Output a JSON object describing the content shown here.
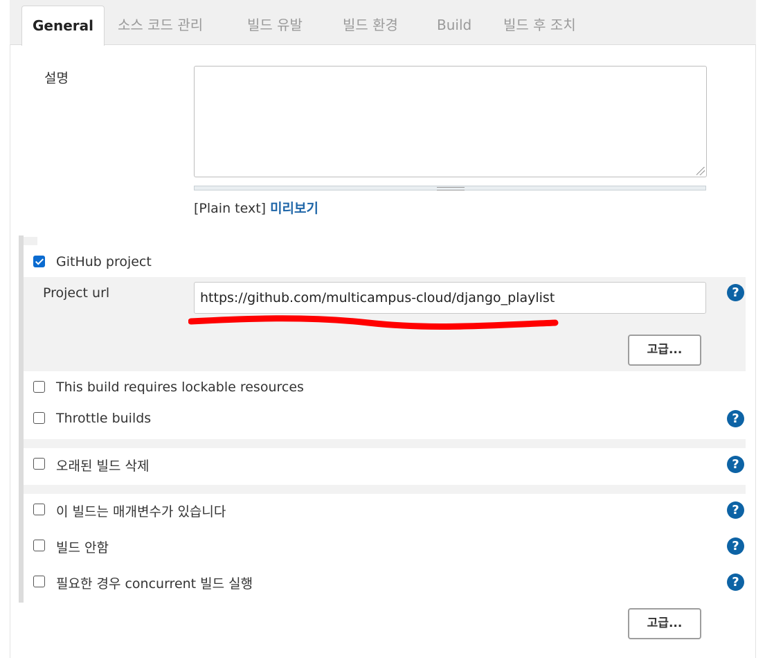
{
  "tabs": [
    {
      "label": "General",
      "active": true
    },
    {
      "label": "소스 코드 관리"
    },
    {
      "label": "빌드 유발"
    },
    {
      "label": "빌드 환경"
    },
    {
      "label": "Build"
    },
    {
      "label": "빌드 후 조치"
    }
  ],
  "description": {
    "label": "설명",
    "value": "",
    "format": "[Plain text]",
    "preview_link": "미리보기"
  },
  "github_project": {
    "label": "GitHub project",
    "checked": true,
    "url_label": "Project url",
    "url_value": "https://github.com/multicampus-cloud/django_playlist",
    "advanced_button": "고급..."
  },
  "options": [
    {
      "label": "This build requires lockable resources",
      "checked": false
    },
    {
      "label": "Throttle builds",
      "checked": false
    },
    {
      "label": "오래된 빌드 삭제",
      "checked": false
    },
    {
      "label": "이 빌드는 매개변수가 있습니다",
      "checked": false
    },
    {
      "label": "빌드 안함",
      "checked": false
    },
    {
      "label": "필요한 경우 concurrent 빌드 실행",
      "checked": false
    }
  ],
  "advanced_button": "고급...",
  "help_glyph": "?",
  "colors": {
    "accent": "#0b6bd0",
    "help": "#0d63a5",
    "link": "#1f66a8",
    "annotation": "#ff0000"
  },
  "icons": {
    "help": "help-circle-icon",
    "check": "check-icon"
  }
}
